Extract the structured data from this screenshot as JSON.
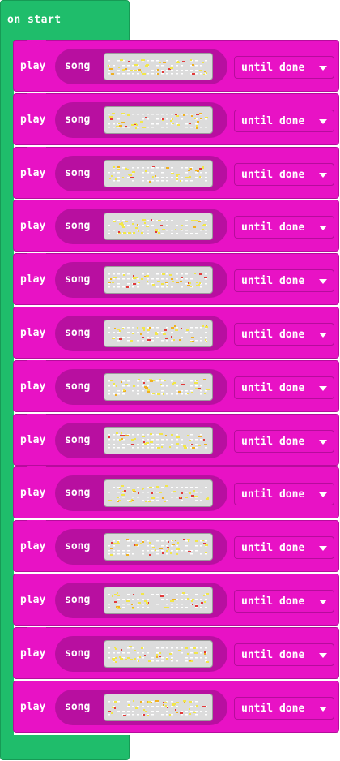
{
  "event_block": {
    "label": "on start",
    "color": "#1fbd6b"
  },
  "statement_color": "#e812c5",
  "blocks": [
    {
      "play_label": "play",
      "song_label": "song",
      "mode_label": "until done",
      "seed": 1
    },
    {
      "play_label": "play",
      "song_label": "song",
      "mode_label": "until done",
      "seed": 2
    },
    {
      "play_label": "play",
      "song_label": "song",
      "mode_label": "until done",
      "seed": 3
    },
    {
      "play_label": "play",
      "song_label": "song",
      "mode_label": "until done",
      "seed": 4
    },
    {
      "play_label": "play",
      "song_label": "song",
      "mode_label": "until done",
      "seed": 5
    },
    {
      "play_label": "play",
      "song_label": "song",
      "mode_label": "until done",
      "seed": 6
    },
    {
      "play_label": "play",
      "song_label": "song",
      "mode_label": "until done",
      "seed": 7
    },
    {
      "play_label": "play",
      "song_label": "song",
      "mode_label": "until done",
      "seed": 8
    },
    {
      "play_label": "play",
      "song_label": "song",
      "mode_label": "until done",
      "seed": 9
    },
    {
      "play_label": "play",
      "song_label": "song",
      "mode_label": "until done",
      "seed": 10
    },
    {
      "play_label": "play",
      "song_label": "song",
      "mode_label": "until done",
      "seed": 11
    },
    {
      "play_label": "play",
      "song_label": "song",
      "mode_label": "until done",
      "seed": 12
    },
    {
      "play_label": "play",
      "song_label": "song",
      "mode_label": "until done",
      "seed": 13
    }
  ]
}
